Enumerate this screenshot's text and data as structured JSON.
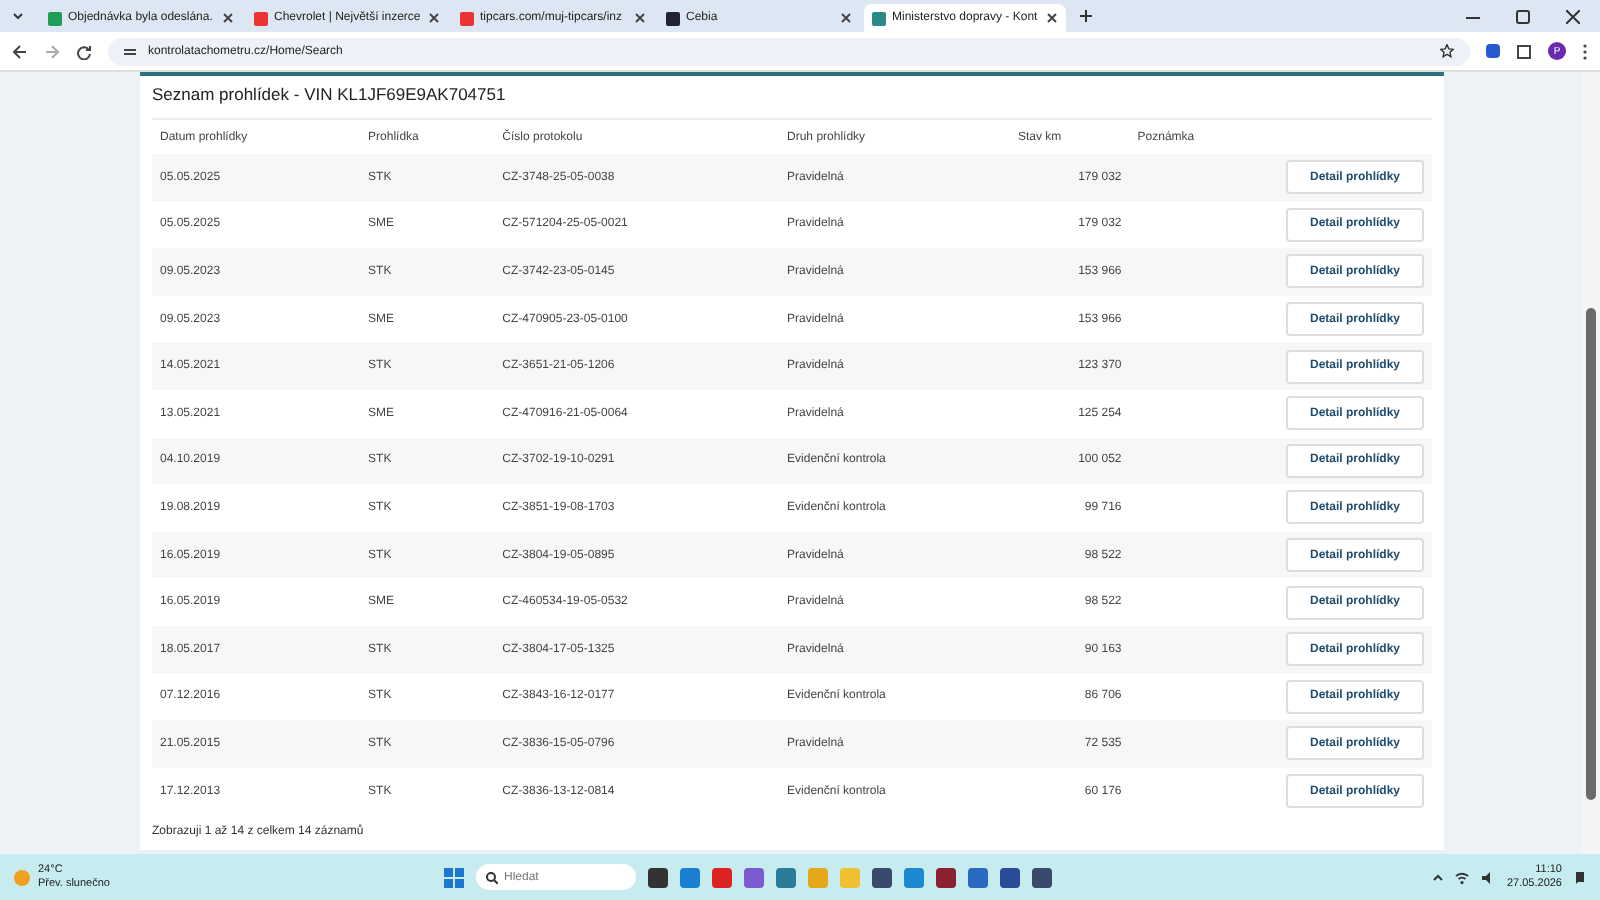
{
  "browser": {
    "tabs": [
      {
        "title": "Objednávka byla odeslána.",
        "selected": false
      },
      {
        "title": "Chevrolet | Největší inzerce",
        "selected": false
      },
      {
        "title": "tipcars.com/muj-tipcars/inz",
        "selected": false
      },
      {
        "title": "Cebia",
        "selected": false
      },
      {
        "title": "Ministerstvo dopravy - Kont",
        "selected": true
      }
    ],
    "address": "kontrolatachometru.cz/Home/Search",
    "profile": "P"
  },
  "page": {
    "title": "Seznam prohlídek - VIN KL1JF69E9AK704751",
    "table": {
      "columns": [
        "Datum prohlídky",
        "Prohlídka",
        "Číslo protokolu",
        "Druh prohlídky",
        "Stav km",
        "Poznámka"
      ],
      "rows": [
        {
          "date": "05.05.2025",
          "type": "STK",
          "protocol": "CZ-3748-25-05-0038",
          "kind": "Pravidelná",
          "km": "179 032",
          "action": "Detail prohlídky"
        },
        {
          "date": "05.05.2025",
          "type": "SME",
          "protocol": "CZ-571204-25-05-0021",
          "kind": "Pravidelná",
          "km": "179 032",
          "action": "Detail prohlídky"
        },
        {
          "date": "09.05.2023",
          "type": "STK",
          "protocol": "CZ-3742-23-05-0145",
          "kind": "Pravidelná",
          "km": "153 966",
          "action": "Detail prohlídky"
        },
        {
          "date": "09.05.2023",
          "type": "SME",
          "protocol": "CZ-470905-23-05-0100",
          "kind": "Pravidelná",
          "km": "153 966",
          "action": "Detail prohlídky"
        },
        {
          "date": "14.05.2021",
          "type": "STK",
          "protocol": "CZ-3651-21-05-1206",
          "kind": "Pravidelná",
          "km": "123 370",
          "action": "Detail prohlídky"
        },
        {
          "date": "13.05.2021",
          "type": "SME",
          "protocol": "CZ-470916-21-05-0064",
          "kind": "Pravidelná",
          "km": "125 254",
          "action": "Detail prohlídky"
        },
        {
          "date": "04.10.2019",
          "type": "STK",
          "protocol": "CZ-3702-19-10-0291",
          "kind": "Evidenční kontrola",
          "km": "100 052",
          "action": "Detail prohlídky"
        },
        {
          "date": "19.08.2019",
          "type": "STK",
          "protocol": "CZ-3851-19-08-1703",
          "kind": "Evidenční kontrola",
          "km": "99 716",
          "action": "Detail prohlídky"
        },
        {
          "date": "16.05.2019",
          "type": "STK",
          "protocol": "CZ-3804-19-05-0895",
          "kind": "Pravidelná",
          "km": "98 522",
          "action": "Detail prohlídky"
        },
        {
          "date": "16.05.2019",
          "type": "SME",
          "protocol": "CZ-460534-19-05-0532",
          "kind": "Pravidelná",
          "km": "98 522",
          "action": "Detail prohlídky"
        },
        {
          "date": "18.05.2017",
          "type": "STK",
          "protocol": "CZ-3804-17-05-1325",
          "kind": "Pravidelná",
          "km": "90 163",
          "action": "Detail prohlídky"
        },
        {
          "date": "07.12.2016",
          "type": "STK",
          "protocol": "CZ-3843-16-12-0177",
          "kind": "Evidenční kontrola",
          "km": "86 706",
          "action": "Detail prohlídky"
        },
        {
          "date": "21.05.2015",
          "type": "STK",
          "protocol": "CZ-3836-15-05-0796",
          "kind": "Pravidelná",
          "km": "72 535",
          "action": "Detail prohlídky"
        },
        {
          "date": "17.12.2013",
          "type": "STK",
          "protocol": "CZ-3836-13-12-0814",
          "kind": "Evidenční kontrola",
          "km": "60 176",
          "action": "Detail prohlídky"
        }
      ]
    },
    "footer": "Zobrazuji 1 až 14 z celkem 14 záznamů"
  },
  "taskbar": {
    "weather": {
      "temp": "24°C",
      "text": "Přev. slunečno"
    },
    "search": {
      "placeholder": "Hledat"
    },
    "time": "11:10",
    "date": "27.05.2026"
  }
}
